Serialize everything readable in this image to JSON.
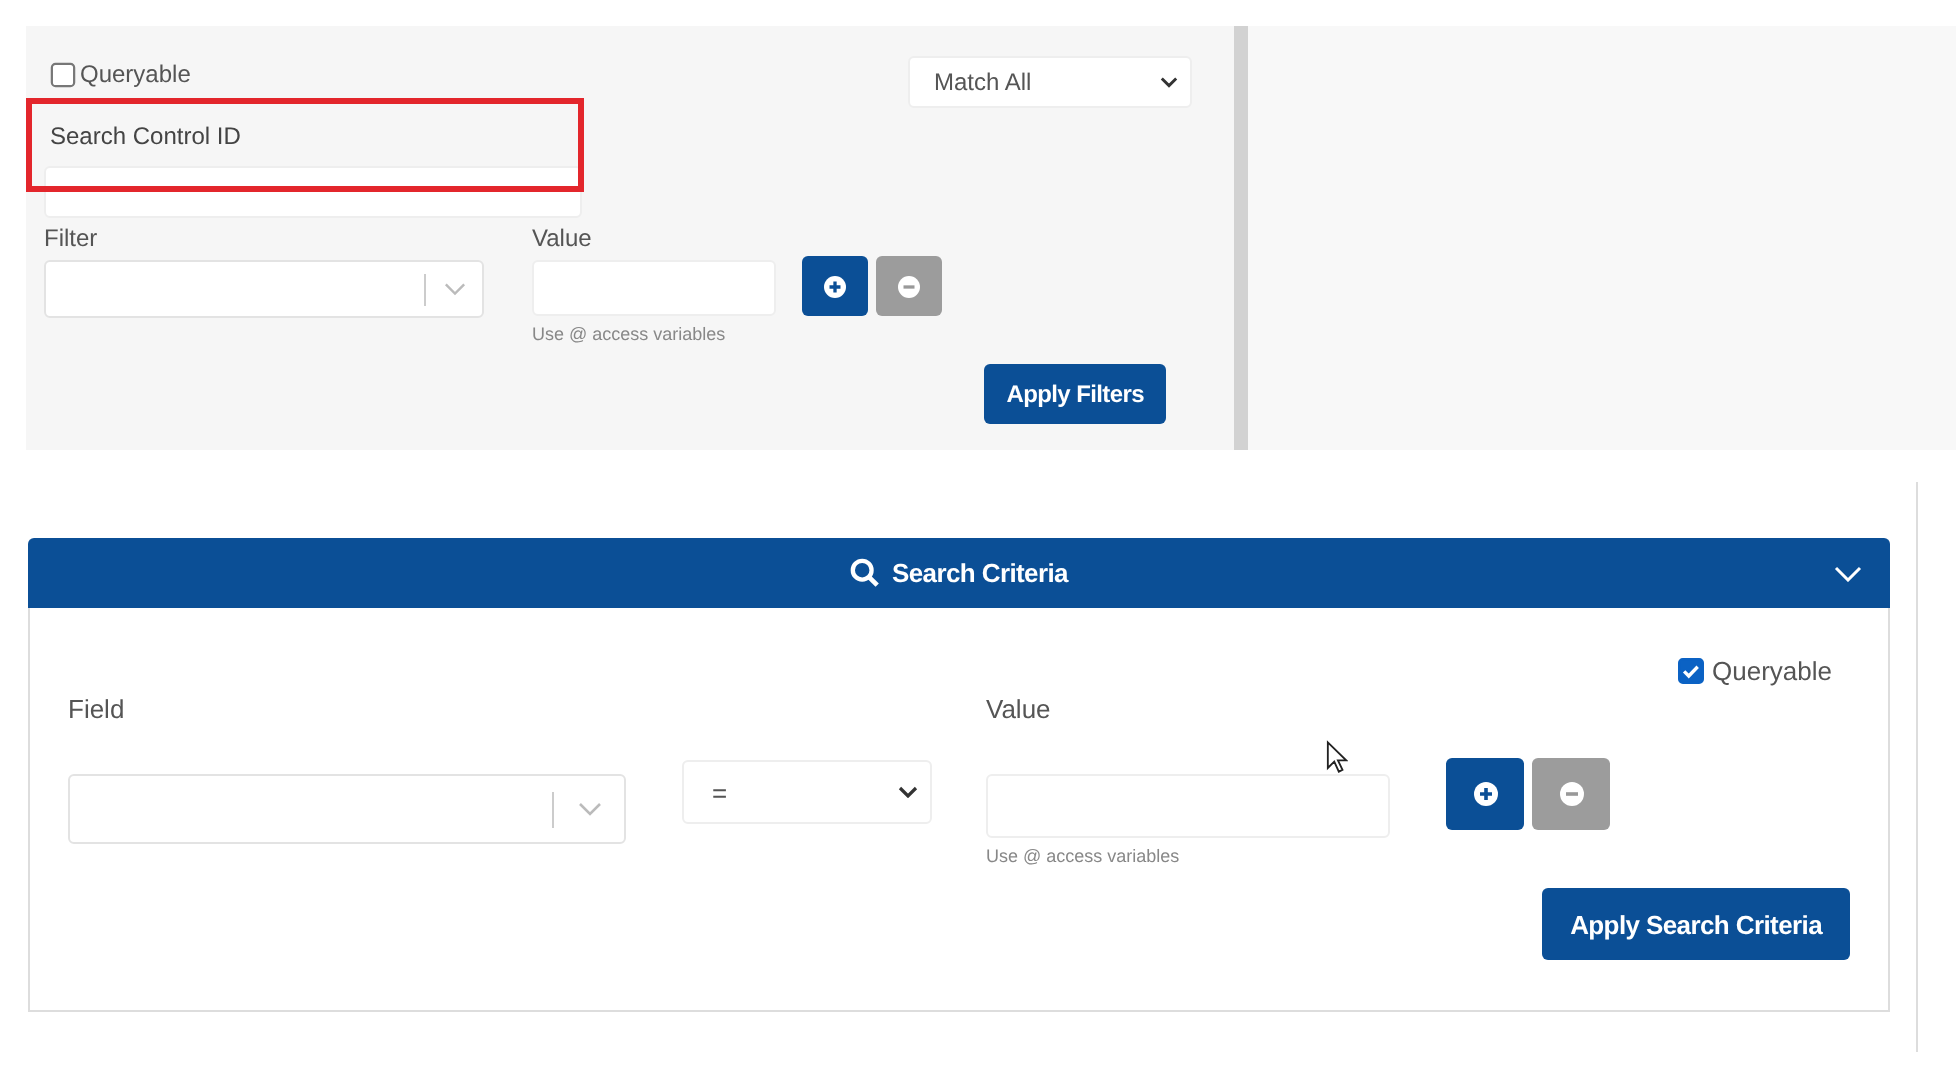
{
  "filter_panel": {
    "queryable": {
      "label": "Queryable",
      "checked": false
    },
    "match_select": {
      "value": "Match All"
    },
    "search_control": {
      "label": "Search Control ID"
    },
    "filter": {
      "label": "Filter"
    },
    "value": {
      "label": "Value",
      "hint": "Use @ access variables"
    },
    "remove_disabled": true,
    "apply_button": "Apply Filters"
  },
  "search_criteria": {
    "title": "Search Criteria",
    "expanded": true,
    "queryable": {
      "label": "Queryable",
      "checked": true
    },
    "field": {
      "label": "Field"
    },
    "operator": {
      "value": "="
    },
    "value": {
      "label": "Value",
      "hint": "Use @ access variables"
    },
    "remove_disabled": true,
    "apply_button": "Apply Search Criteria"
  }
}
